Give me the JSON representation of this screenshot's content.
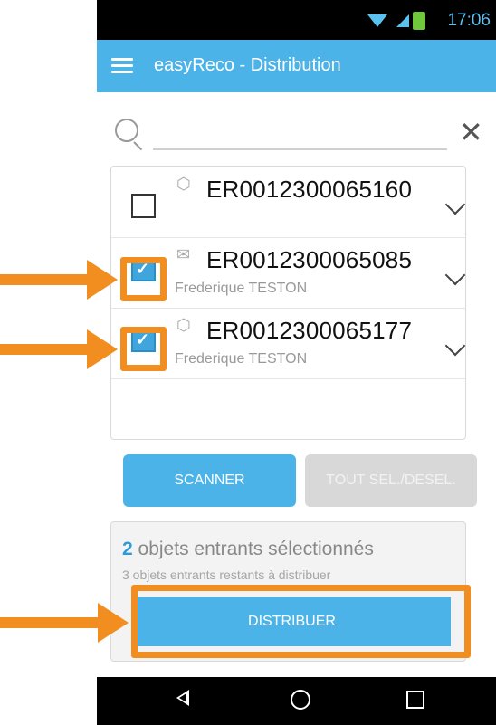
{
  "status_bar": {
    "time": "17:06"
  },
  "app_bar": {
    "title": "easyReco - Distribution"
  },
  "search": {
    "value": "",
    "placeholder": ""
  },
  "items": [
    {
      "code": "ER0012300065160",
      "recipient": "",
      "type_icon": "package-icon",
      "checked": false
    },
    {
      "code": "ER0012300065085",
      "recipient": "Frederique TESTON",
      "type_icon": "envelope-icon",
      "checked": true
    },
    {
      "code": "ER0012300065177",
      "recipient": "Frederique TESTON",
      "type_icon": "package-icon",
      "checked": true
    }
  ],
  "buttons": {
    "scanner": "SCANNER",
    "toggle_all": "TOUT SEL./DESEL.",
    "distribute": "DISTRIBUER"
  },
  "summary": {
    "selected_count": "2",
    "selected_text": "objets entrants sélectionnés",
    "remaining_text": "3 objets entrants restants à distribuer"
  },
  "colors": {
    "accent": "#4cb3e9",
    "highlight": "#f28e1f"
  }
}
